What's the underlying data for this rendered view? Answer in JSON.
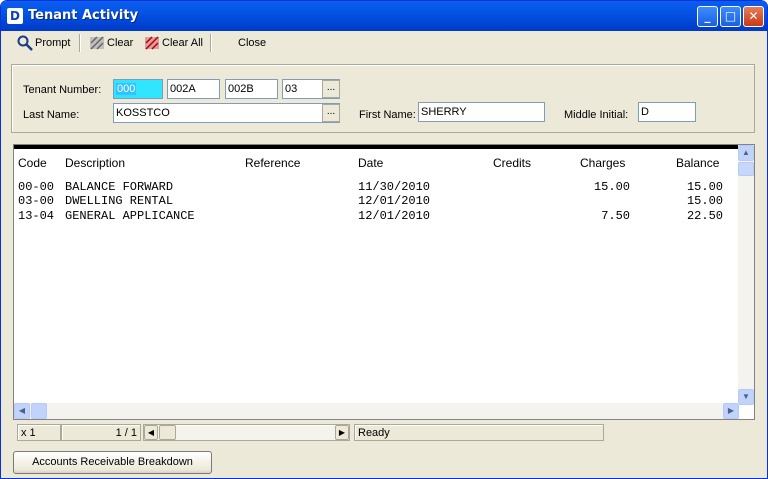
{
  "window": {
    "title": "Tenant Activity",
    "title_icon": "app-icon",
    "controls": [
      "minimize",
      "maximize",
      "close"
    ]
  },
  "toolbar": {
    "prompt": "Prompt",
    "clear": "Clear",
    "clear_all": "Clear All",
    "close": "Close"
  },
  "form": {
    "tenant_number_label": "Tenant Number:",
    "tenant_number": [
      "000",
      "002A",
      "002B",
      "03"
    ],
    "last_name_label": "Last Name:",
    "last_name": "KOSSTCO",
    "first_name_label": "First Name:",
    "first_name": "SHERRY",
    "middle_initial_label": "Middle Initial:",
    "middle_initial": "D",
    "lookup_label": "..."
  },
  "table": {
    "columns": [
      "Code",
      "Description",
      "Reference",
      "Date",
      "Credits",
      "Charges",
      "Balance"
    ],
    "rows": [
      {
        "code": "00-00",
        "description": "BALANCE FORWARD",
        "reference": "",
        "date": "11/30/2010",
        "credits": "",
        "charges": "15.00",
        "balance": "15.00"
      },
      {
        "code": "03-00",
        "description": "DWELLING RENTAL",
        "reference": "",
        "date": "12/01/2010",
        "credits": "",
        "charges": "",
        "balance": "15.00"
      },
      {
        "code": "13-04",
        "description": "GENERAL APPLICANCE",
        "reference": "",
        "date": "12/01/2010",
        "credits": "",
        "charges": "7.50",
        "balance": "22.50"
      }
    ]
  },
  "status": {
    "zoom": "x 1",
    "page": "1 / 1",
    "state": "Ready"
  },
  "buttons": {
    "ar_breakdown": "Accounts Receivable Breakdown"
  }
}
